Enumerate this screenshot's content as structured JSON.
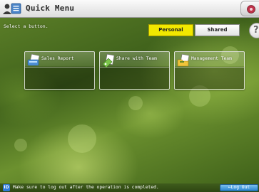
{
  "header": {
    "title": "Quick Menu",
    "title_icon": "users-menu-icon",
    "corner_icon": "settings-icon"
  },
  "main": {
    "instruction": "Select a button.",
    "tabs": [
      {
        "label": "Personal",
        "selected": true,
        "color": "#f2e800"
      },
      {
        "label": "Shared",
        "selected": false
      }
    ],
    "help_label": "?",
    "buttons": [
      {
        "label": "Sales Report",
        "icon": "scan-document-icon"
      },
      {
        "label": "Share with Team",
        "icon": "share-document-icon"
      },
      {
        "label": "Management Team",
        "icon": "folder-document-icon"
      }
    ]
  },
  "footer": {
    "info_label": "ID",
    "message": "Make sure to log out after the operation is completed.",
    "logout_label": "Log Out",
    "logout_prefix": "←"
  }
}
